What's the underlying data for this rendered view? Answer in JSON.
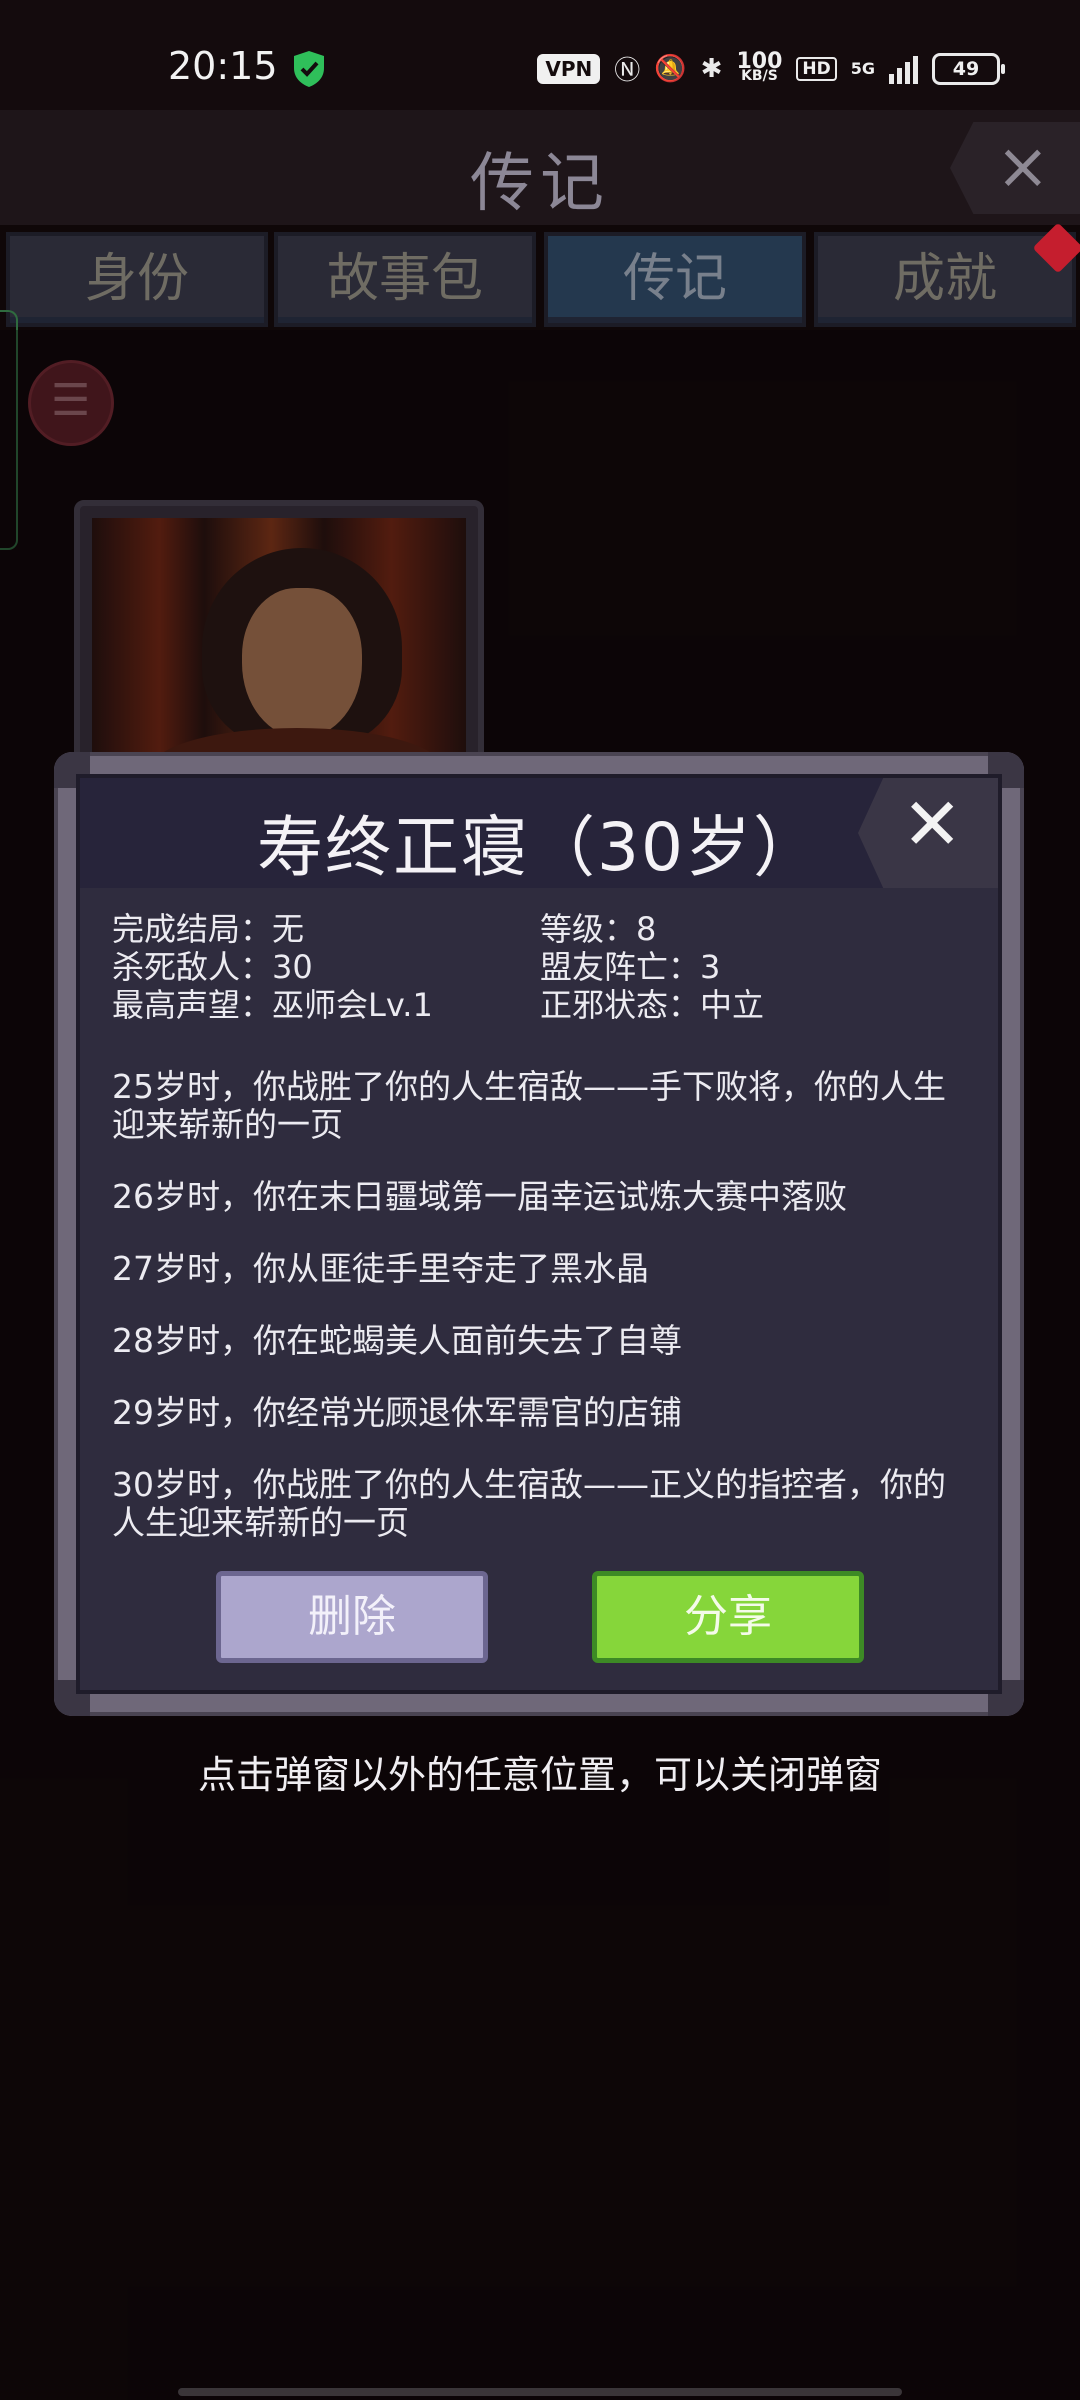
{
  "status_bar": {
    "time": "20:15",
    "vpn": "VPN",
    "net_speed_value": "100",
    "net_speed_unit": "KB/S",
    "hd": "HD",
    "network": "5G",
    "battery": "49"
  },
  "header": {
    "title": "传记",
    "close_icon": "×"
  },
  "tabs": [
    {
      "label": "身份"
    },
    {
      "label": "故事包"
    },
    {
      "label": "传记"
    },
    {
      "label": "成就"
    }
  ],
  "modal": {
    "title": "寿终正寝（30岁）",
    "close_icon": "✕",
    "stats": {
      "ending": "完成结局：无",
      "level": "等级：8",
      "kills": "杀死敌人：30",
      "ally_deaths": "盟友阵亡：3",
      "reputation": "最高声望：巫师会Lv.1",
      "alignment": "正邪状态：中立"
    },
    "story": [
      "25岁时，你战胜了你的人生宿敌——手下败将，你的人生迎来崭新的一页",
      "26岁时，你在末日疆域第一届幸运试炼大赛中落败",
      "27岁时，你从匪徒手里夺走了黑水晶",
      "28岁时，你在蛇蝎美人面前失去了自尊",
      "29岁时，你经常光顾退休军需官的店铺",
      "30岁时，你战胜了你的人生宿敌——正义的指控者，你的人生迎来崭新的一页"
    ],
    "delete_label": "删除",
    "share_label": "分享"
  },
  "hint": "点击弹窗以外的任意位置，可以关闭弹窗"
}
